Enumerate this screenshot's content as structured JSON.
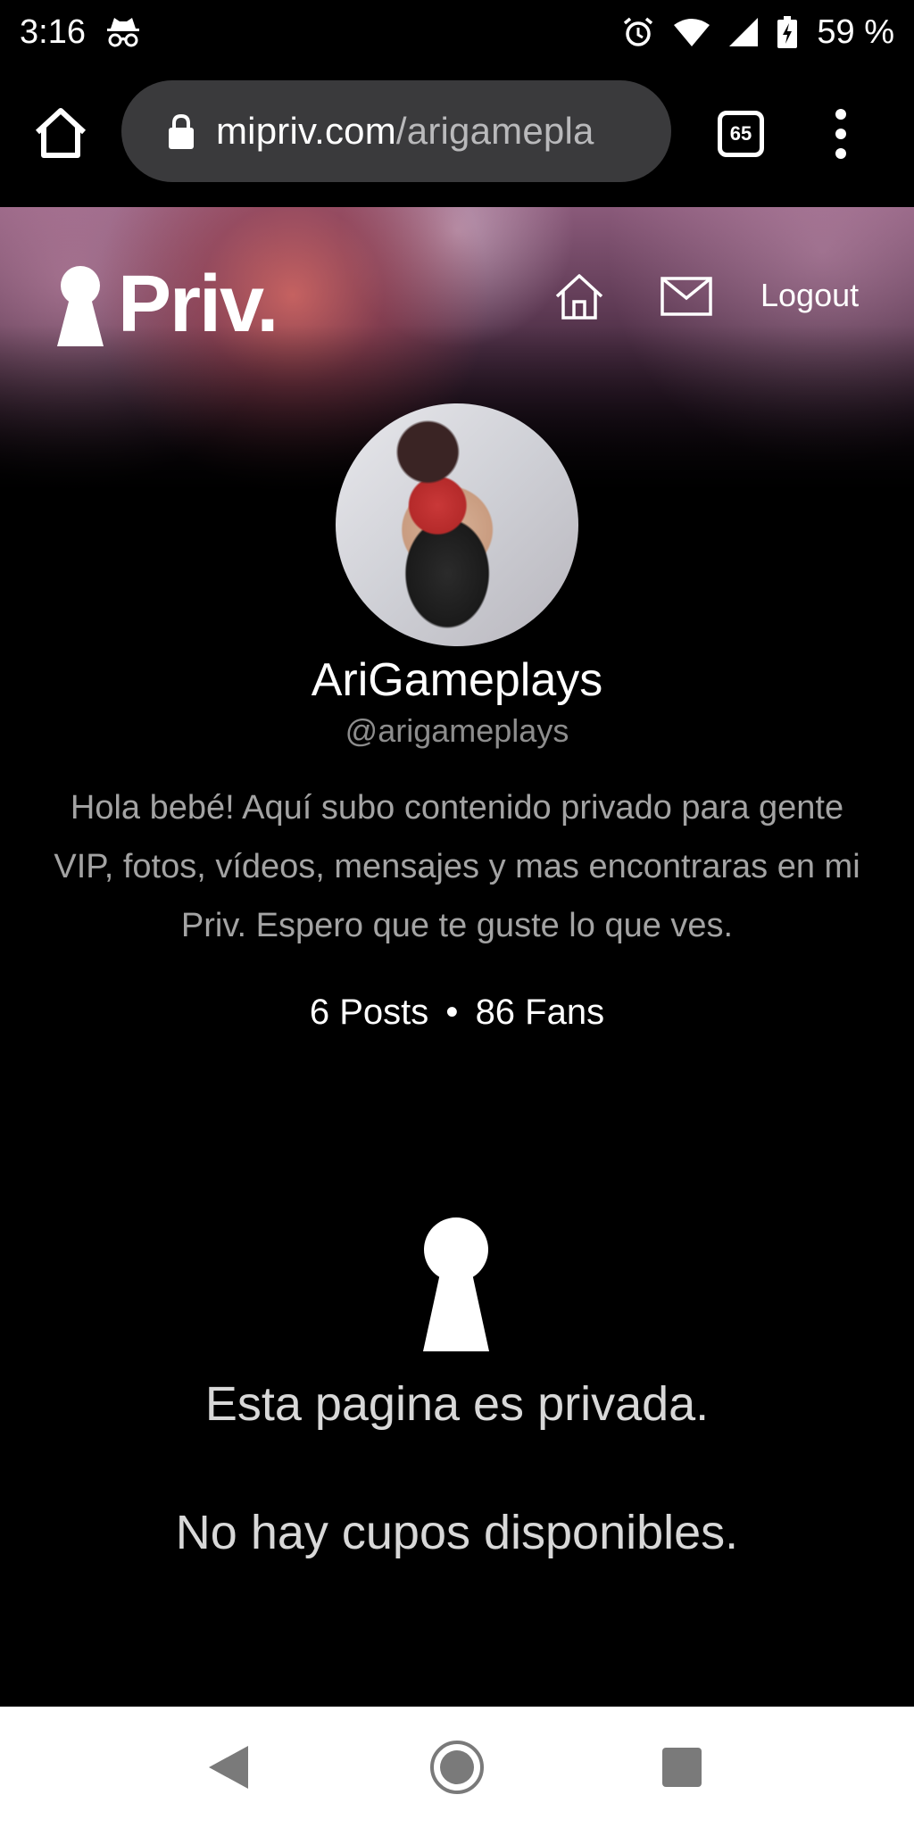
{
  "status_bar": {
    "time": "3:16",
    "battery": "59 %",
    "icons": [
      "incognito-icon",
      "alarm-icon",
      "wifi-icon",
      "signal-icon",
      "battery-charging-icon"
    ]
  },
  "browser": {
    "url_domain": "mipriv.com",
    "url_path": "/arigamepla",
    "tab_count": "65",
    "icons": [
      "home-icon",
      "lock-icon",
      "more-vert-icon"
    ]
  },
  "site_header": {
    "logo_text": "Priv.",
    "logout_label": "Logout",
    "icons": [
      "keyhole-logo-icon",
      "home-icon",
      "mail-icon"
    ]
  },
  "profile": {
    "display_name": "AriGameplays",
    "handle": "@arigameplays",
    "bio_lines": [
      "Hola bebé! Aquí subo contenido privado para gente",
      "VIP, fotos, vídeos, mensajes y mas encontraras en mi",
      "Priv. Espero que te guste lo que ves."
    ],
    "posts": "6 Posts",
    "separator": "•",
    "fans": "86 Fans"
  },
  "private_notice": {
    "message": "Esta pagina es privada.",
    "slots_message": "No hay cupos disponibles.",
    "icon": "keyhole-icon"
  },
  "android_nav": {
    "icons": [
      "back-icon",
      "home-circle-icon",
      "recents-icon"
    ]
  },
  "colors": {
    "background": "#000000",
    "url_pill": "#3a3a3c",
    "muted_text": "#8d8d8d",
    "bio_text": "#a3a3a3",
    "nav_bar": "#ffffff"
  }
}
